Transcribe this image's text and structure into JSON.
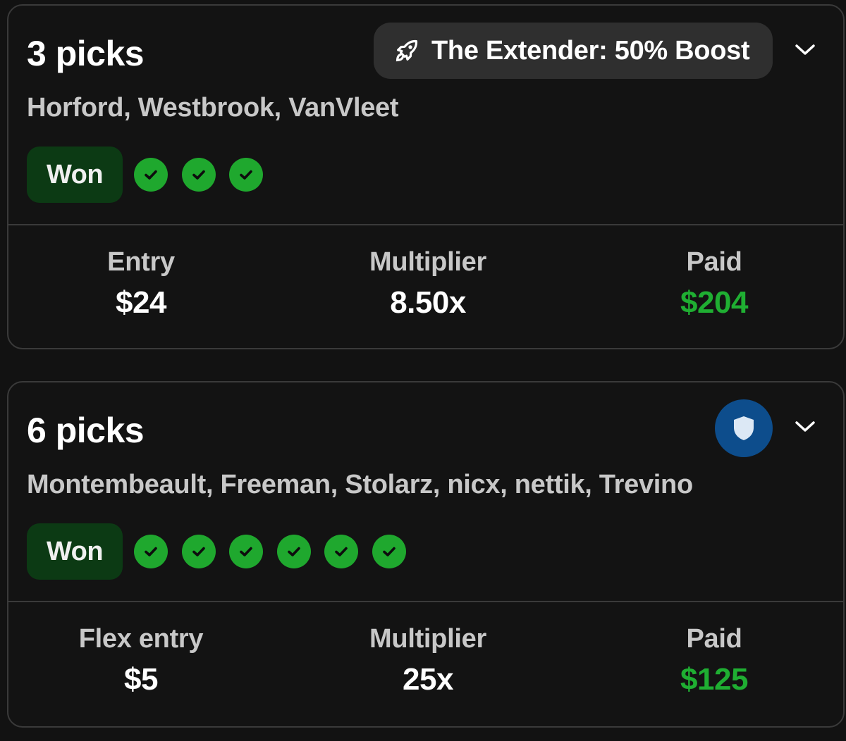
{
  "colors": {
    "background": "#121212",
    "card_border": "#3a3a3a",
    "won_badge_bg": "#0c3a14",
    "check_green": "#1fa82e",
    "paid_green": "#1fae32",
    "shield_blue": "#0d4d8c",
    "boost_bg": "#2f2f2f"
  },
  "cards": [
    {
      "title": "3 picks",
      "boost": {
        "icon": "rocket-icon",
        "label": "The Extender: 50% Boost"
      },
      "players": "Horford, Westbrook, VanVleet",
      "status": "Won",
      "picks_won": 3,
      "stats": [
        {
          "label": "Entry",
          "value": "$24"
        },
        {
          "label": "Multiplier",
          "value": "8.50x"
        },
        {
          "label": "Paid",
          "value": "$204"
        }
      ]
    },
    {
      "title": "6 picks",
      "badge_icon": "shield-icon",
      "players": "Montembeault, Freeman, Stolarz, nicx, nettik, Trevino",
      "status": "Won",
      "picks_won": 6,
      "stats": [
        {
          "label": "Flex entry",
          "value": "$5"
        },
        {
          "label": "Multiplier",
          "value": "25x"
        },
        {
          "label": "Paid",
          "value": "$125"
        }
      ]
    }
  ]
}
